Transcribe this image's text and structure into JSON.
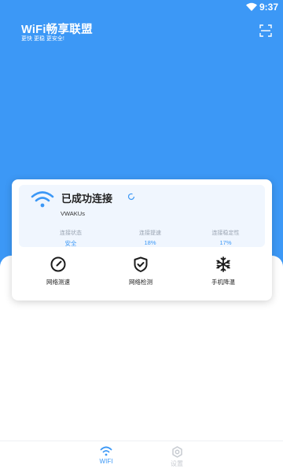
{
  "status_bar": {
    "time": "9:37"
  },
  "header": {
    "title": "WiFi畅享联盟",
    "subtitle": "更快 更稳 更安全!"
  },
  "connection": {
    "status": "已成功连接",
    "ssid": "VWAKUs",
    "metrics": [
      {
        "label": "连接状态",
        "value": "安全"
      },
      {
        "label": "连接提速",
        "value": "18%"
      },
      {
        "label": "连接稳定性",
        "value": "17%"
      }
    ]
  },
  "actions": [
    {
      "label": "网络测速",
      "icon": "speedometer-icon"
    },
    {
      "label": "网络检测",
      "icon": "shield-icon"
    },
    {
      "label": "手机降温",
      "icon": "snowflake-icon"
    }
  ],
  "bottom_nav": [
    {
      "label": "WIFI",
      "icon": "wifi-icon",
      "active": true
    },
    {
      "label": "设置",
      "icon": "gear-icon",
      "active": false
    }
  ],
  "colors": {
    "primary": "#3c98f6",
    "card_tint": "#f0f6fe",
    "inactive": "#c7cbd1"
  }
}
